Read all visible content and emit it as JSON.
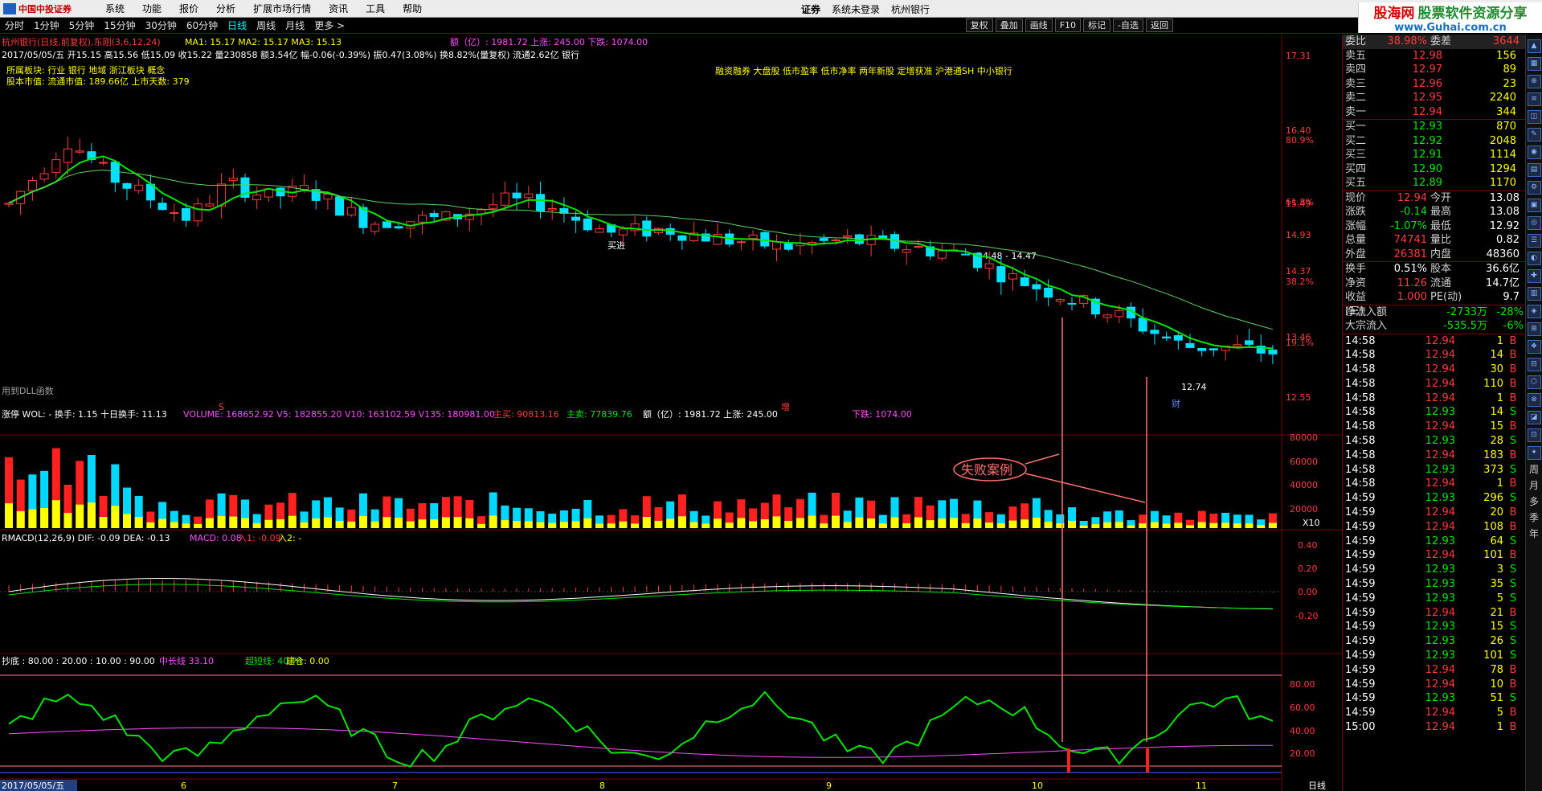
{
  "menubar": {
    "logo": "中国中投证券",
    "items": [
      "系统",
      "功能",
      "报价",
      "分析",
      "扩展市场行情",
      "资讯",
      "工具",
      "帮助"
    ],
    "center_title": "证券",
    "center_sub1": "系统未登录",
    "center_sub2": "杭州银行",
    "trade_button": "行 情",
    "ad_line1": "股海网",
    "ad_line1b": "股票软件资源分享",
    "ad_line2": "www.Guhai.com.cn"
  },
  "toolbar": {
    "periods": [
      "分时",
      "1分钟",
      "5分钟",
      "15分钟",
      "30分钟",
      "60分钟",
      "日线",
      "周线",
      "月线",
      "更多 >"
    ],
    "active": "日线",
    "right_buttons": [
      "复权",
      "叠加",
      "画线",
      "F10",
      "标记",
      "-自选",
      "返回"
    ]
  },
  "kline": {
    "title": "杭州银行(日线,前复权),东刚(3,6,12,24)",
    "ma_info": "MA1: 15.17  MA2: 15.17  MA3: 15.13",
    "amount_info": "额（亿）: 1981.72 上涨: 245.00 下跌: 1074.00",
    "bar_info": "2017/05/05/五 开15.15 高15.56 低15.09 收15.22 量230858 额3.54亿 幅-0.06(-0.39%) 振0.47(3.08%) 换8.82%(量复权) 流通2.62亿 银行",
    "sector": "所属板块: 行业 银行 地域 浙江板块 概念",
    "market": "股本市值: 流通市值: 189.66亿 上市天数: 379",
    "concepts": "融资融券 大盘股 低市盈率 低市净率 两年新股 定增获准 沪港通SH 中小银行",
    "dll": "用到DLL函数",
    "buy_label": "买进",
    "level_label": "14.48 - 14.47",
    "low_label": "12.74",
    "cai_label": "财",
    "zeng_label": "增",
    "s_label": "S",
    "y_labels": [
      "17.31",
      "16.40",
      "15.49",
      "14.93",
      "14.37",
      "13.46",
      "12.55"
    ],
    "pct_labels": [
      "80.9%",
      "61.8%",
      "38.2%",
      "19.1%"
    ]
  },
  "volume_panel": {
    "header_a": "涨停 WOL: -  换手: 1.15 十日换手: 11.13",
    "header_b": "VOLUME: 168652.92  V5: 182855.20  V10: 163102.59  V135: 180981.00",
    "header_c": "主买: 90813.16",
    "header_d": "主卖: 77839.76",
    "header_e": "额（亿）: 1981.72 上涨: 245.00",
    "header_f": "下跌: 1074.00",
    "y_labels": [
      "80000",
      "60000",
      "40000",
      "20000"
    ],
    "unit": "X10"
  },
  "macd_panel": {
    "header_a": "RMACD(12,26,9)  DIF: -0.09  DEA: -0.13",
    "header_b": "MACD: 0.08",
    "header_c": "入1: -0.09",
    "header_d": "入2: -",
    "y_labels": [
      "0.40",
      "0.20",
      "0.00",
      "-0.20"
    ]
  },
  "bottom_panel": {
    "header_a": "抄底 : 80.00 : 20.00 : 10.00 : 90.00",
    "header_b": "中长线 33.10",
    "header_c": "超短线: 40.74",
    "header_d": "建仓: 0.00",
    "y_labels": [
      "80.00",
      "60.00",
      "40.00",
      "20.00"
    ],
    "annotation": "失败案例",
    "x_labels": [
      "2017/05/05/五",
      "6",
      "7",
      "8",
      "9",
      "10",
      "11"
    ],
    "period_label": "日线"
  },
  "quote": {
    "weibi": {
      "label": "委比",
      "value": "38.98%",
      "label2": "委差",
      "value2": "3644"
    },
    "asks": [
      {
        "label": "卖五",
        "price": "12.98",
        "vol": "156"
      },
      {
        "label": "卖四",
        "price": "12.97",
        "vol": "89"
      },
      {
        "label": "卖三",
        "price": "12.96",
        "vol": "23"
      },
      {
        "label": "卖二",
        "price": "12.95",
        "vol": "2240"
      },
      {
        "label": "卖一",
        "price": "12.94",
        "vol": "344"
      }
    ],
    "bids": [
      {
        "label": "买一",
        "price": "12.93",
        "vol": "870"
      },
      {
        "label": "买二",
        "price": "12.92",
        "vol": "2048"
      },
      {
        "label": "买三",
        "price": "12.91",
        "vol": "1114"
      },
      {
        "label": "买四",
        "price": "12.90",
        "vol": "1294"
      },
      {
        "label": "买五",
        "price": "12.89",
        "vol": "1170"
      }
    ],
    "stats": [
      [
        "现价",
        "12.94",
        "今开",
        "13.08"
      ],
      [
        "涨跌",
        "-0.14",
        "最高",
        "13.08"
      ],
      [
        "涨幅",
        "-1.07%",
        "最低",
        "12.92"
      ],
      [
        "总量",
        "74741",
        "量比",
        "0.82"
      ],
      [
        "外盘",
        "26381",
        "内盘",
        "48360"
      ]
    ],
    "stats2": [
      [
        "换手",
        "0.51%",
        "股本",
        "36.6亿"
      ],
      [
        "净资",
        "11.26",
        "流通",
        "14.7亿"
      ],
      [
        "收益(三)",
        "1.000",
        "PE(动)",
        "9.7"
      ]
    ],
    "flows": [
      [
        "净流入额",
        "-2733万",
        "-28%"
      ],
      [
        "大宗流入",
        "-535.5万",
        "-6%"
      ]
    ]
  },
  "ticks": [
    [
      "14:58",
      "12.94",
      "1",
      "B"
    ],
    [
      "14:58",
      "12.94",
      "14",
      "B"
    ],
    [
      "14:58",
      "12.94",
      "30",
      "B"
    ],
    [
      "14:58",
      "12.94",
      "110",
      "B"
    ],
    [
      "14:58",
      "12.94",
      "1",
      "B"
    ],
    [
      "14:58",
      "12.93",
      "14",
      "S"
    ],
    [
      "14:58",
      "12.94",
      "15",
      "B"
    ],
    [
      "14:58",
      "12.93",
      "28",
      "S"
    ],
    [
      "14:58",
      "12.94",
      "183",
      "B"
    ],
    [
      "14:58",
      "12.93",
      "373",
      "S"
    ],
    [
      "14:58",
      "12.94",
      "1",
      "B"
    ],
    [
      "14:59",
      "12.93",
      "296",
      "S"
    ],
    [
      "14:59",
      "12.94",
      "20",
      "B"
    ],
    [
      "14:59",
      "12.94",
      "108",
      "B"
    ],
    [
      "14:59",
      "12.93",
      "64",
      "S"
    ],
    [
      "14:59",
      "12.94",
      "101",
      "B"
    ],
    [
      "14:59",
      "12.93",
      "3",
      "S"
    ],
    [
      "14:59",
      "12.93",
      "35",
      "S"
    ],
    [
      "14:59",
      "12.93",
      "5",
      "S"
    ],
    [
      "14:59",
      "12.94",
      "21",
      "B"
    ],
    [
      "14:59",
      "12.93",
      "15",
      "S"
    ],
    [
      "14:59",
      "12.93",
      "26",
      "S"
    ],
    [
      "14:59",
      "12.93",
      "101",
      "S"
    ],
    [
      "14:59",
      "12.94",
      "78",
      "B"
    ],
    [
      "14:59",
      "12.94",
      "10",
      "B"
    ],
    [
      "14:59",
      "12.93",
      "51",
      "S"
    ],
    [
      "14:59",
      "12.94",
      "5",
      "B"
    ],
    [
      "15:00",
      "12.94",
      "1",
      "B"
    ]
  ],
  "vtool": [
    "周",
    "月",
    "多",
    "季",
    "年"
  ],
  "colors": {
    "up": "#ff3b3b",
    "down": "#00e0ff",
    "ma_green": "#00e600",
    "grid": "#7a0000",
    "highlight": "#ff6b6b"
  }
}
